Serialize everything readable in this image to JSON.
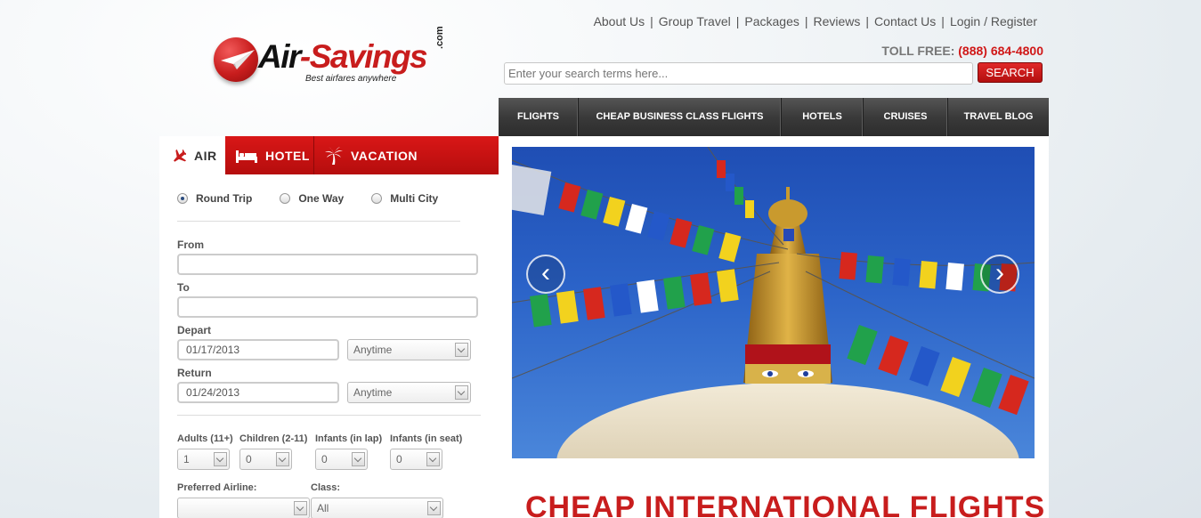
{
  "logo": {
    "brand_part1": "Air",
    "brand_dash": "-",
    "brand_part2": "Savings",
    "dotcom": ".com",
    "tagline": "Best airfares anywhere"
  },
  "top_links": [
    "About Us",
    "Group Travel",
    "Packages",
    "Reviews",
    "Contact Us",
    "Login / Register"
  ],
  "toll": {
    "label": "TOLL FREE:",
    "phone": "(888) 684-4800"
  },
  "search": {
    "placeholder": "Enter your search terms here...",
    "button": "SEARCH"
  },
  "nav": [
    "FLIGHTS",
    "CHEAP BUSINESS CLASS FLIGHTS",
    "HOTELS",
    "CRUISES",
    "TRAVEL BLOG"
  ],
  "tabs": [
    {
      "label": "AIR",
      "icon": "airplane-icon",
      "active": true
    },
    {
      "label": "HOTEL",
      "icon": "bed-icon",
      "active": false
    },
    {
      "label": "VACATION",
      "icon": "palm-tree-icon",
      "active": false
    }
  ],
  "trip_types": [
    {
      "label": "Round Trip",
      "selected": true
    },
    {
      "label": "One Way",
      "selected": false
    },
    {
      "label": "Multi City",
      "selected": false
    }
  ],
  "form": {
    "from_label": "From",
    "from_value": "",
    "to_label": "To",
    "to_value": "",
    "depart_label": "Depart",
    "depart_date": "01/17/2013",
    "depart_time": "Anytime",
    "return_label": "Return",
    "return_date": "01/24/2013",
    "return_time": "Anytime",
    "adults_label": "Adults (11+)",
    "adults_value": "1",
    "children_label": "Children (2-11)",
    "children_value": "0",
    "infants_lap_label": "Infants (in lap)",
    "infants_lap_value": "0",
    "infants_seat_label": "Infants (in seat)",
    "infants_seat_value": "0",
    "airline_label": "Preferred Airline:",
    "airline_value": "",
    "class_label": "Class:",
    "class_value": "All"
  },
  "headline": "CHEAP INTERNATIONAL FLIGHTS",
  "colors": {
    "accent": "#c81d1d",
    "nav_bg": "#3a3a3a"
  }
}
